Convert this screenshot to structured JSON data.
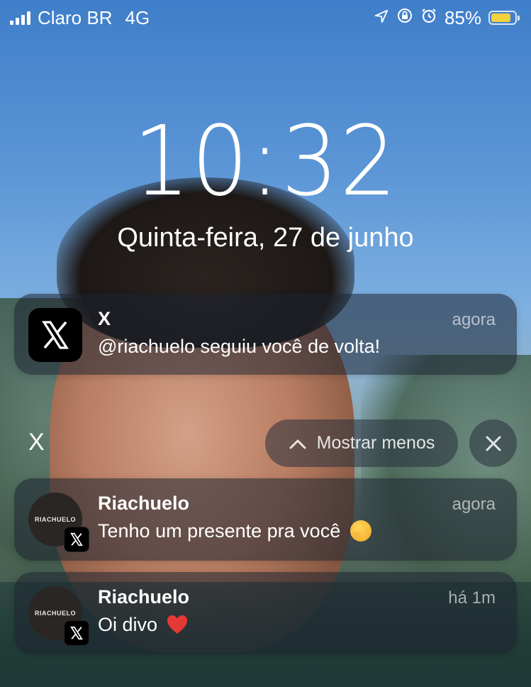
{
  "status_bar": {
    "carrier": "Claro BR",
    "network": "4G",
    "battery_percent": "85%",
    "battery_level": 0.85,
    "icons": [
      "signal-icon",
      "location-icon",
      "orientation-lock-icon",
      "alarm-icon",
      "battery-icon"
    ]
  },
  "lock_screen": {
    "time": "10:32",
    "date": "Quinta-feira, 27 de junho"
  },
  "notifications": {
    "x_single": {
      "app": "X",
      "time": "agora",
      "text": "@riachuelo seguiu você de volta!"
    },
    "group": {
      "label": "X",
      "show_less": "Mostrar menos"
    },
    "items": [
      {
        "title": "Riachuelo",
        "time": "agora",
        "text": "Tenho um presente pra você",
        "avatar_text": "RIACHUELO",
        "emoji": "hand-over-mouth-emoji"
      },
      {
        "title": "Riachuelo",
        "time": "há 1m",
        "text": "Oi divo",
        "avatar_text": "RIACHUELO",
        "emoji": "red-heart-emoji"
      }
    ]
  },
  "colors": {
    "battery_fill": "#f2d13c",
    "card_bg": "rgba(28,35,48,0.55)"
  }
}
